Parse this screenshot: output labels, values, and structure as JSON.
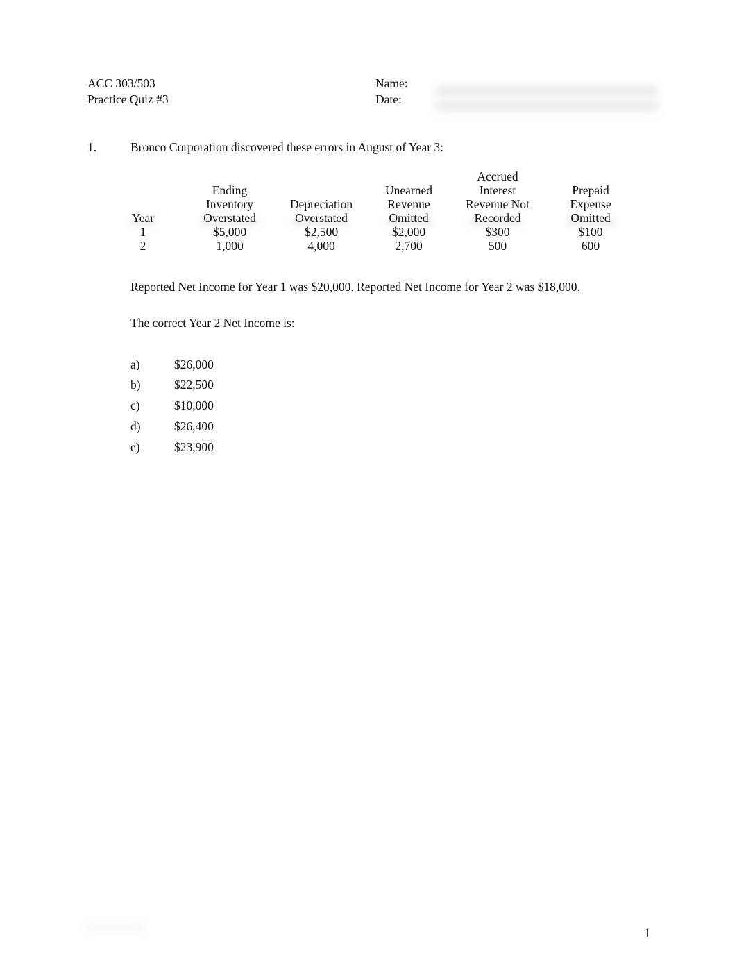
{
  "header": {
    "course": "ACC 303/503",
    "quiz": "Practice Quiz #3",
    "name_label": "Name:",
    "date_label": "Date:"
  },
  "question": {
    "number": "1.",
    "prompt": "Bronco Corporation discovered these errors in August of Year 3:",
    "table": {
      "columns": [
        {
          "header": [
            "",
            "",
            "",
            "Year"
          ],
          "values": [
            "1",
            "2"
          ]
        },
        {
          "header": [
            "",
            "Ending",
            "Inventory",
            "Overstated"
          ],
          "values": [
            "$5,000",
            "1,000"
          ]
        },
        {
          "header": [
            "",
            "",
            "Depreciation",
            "Overstated"
          ],
          "values": [
            "$2,500",
            "4,000"
          ]
        },
        {
          "header": [
            "",
            "Unearned",
            "Revenue",
            "Omitted"
          ],
          "values": [
            "$2,000",
            "2,700"
          ]
        },
        {
          "header": [
            "Accrued",
            "Interest",
            "Revenue Not",
            "Recorded"
          ],
          "values": [
            "$300",
            "500"
          ]
        },
        {
          "header": [
            "",
            "Prepaid",
            "Expense",
            "Omitted"
          ],
          "values": [
            "$100",
            "600"
          ]
        }
      ]
    },
    "info": "Reported Net Income for Year 1 was $20,000. Reported Net Income for Year 2 was $18,000.",
    "ask": "The correct Year 2 Net Income is:",
    "options": [
      {
        "letter": "a)",
        "value": "$26,000"
      },
      {
        "letter": "b)",
        "value": "$22,500"
      },
      {
        "letter": "c)",
        "value": "$10,000"
      },
      {
        "letter": "d)",
        "value": "$26,400"
      },
      {
        "letter": "e)",
        "value": "$23,900"
      }
    ]
  },
  "footer": {
    "page_number": "1"
  }
}
